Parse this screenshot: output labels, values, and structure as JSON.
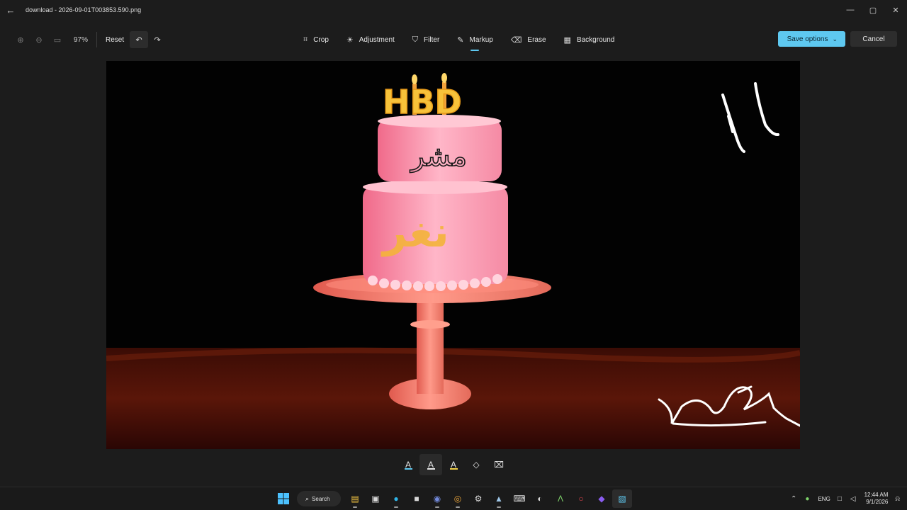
{
  "window": {
    "title": "download - 2026-09-01T003853.590.png",
    "back_icon": "←",
    "minimize_icon": "—",
    "maximize_icon": "▢",
    "close_icon": "✕"
  },
  "toolbar": {
    "zoom_in_icon": "⊕",
    "zoom_out_icon": "⊖",
    "fit_icon": "▭",
    "zoom_level": "97%",
    "reset_label": "Reset",
    "undo_icon": "↶",
    "redo_icon": "↷",
    "tools": [
      {
        "label": "Crop",
        "icon": "⌗"
      },
      {
        "label": "Adjustment",
        "icon": "☀"
      },
      {
        "label": "Filter",
        "icon": "⛉"
      },
      {
        "label": "Markup",
        "icon": "✎"
      },
      {
        "label": "Erase",
        "icon": "⌫"
      },
      {
        "label": "Background",
        "icon": "▦"
      }
    ],
    "active_tool": "Markup",
    "save_label": "Save options",
    "save_chevron": "⌄",
    "cancel_label": "Cancel"
  },
  "canvas": {
    "cake_text_top": "HBD",
    "cake_text_middle": "مشر",
    "cake_text_bottom": "نغر",
    "drawn_number": "11"
  },
  "markup_pens": [
    {
      "name": "ballpoint-pen",
      "icon": "A",
      "color": "#5ec8f0"
    },
    {
      "name": "pencil",
      "icon": "A",
      "color": "#e6e6e6"
    },
    {
      "name": "highlighter",
      "icon": "A",
      "color": "#f2d24a"
    },
    {
      "name": "eraser",
      "icon": "◇",
      "color": "#e6e6e6"
    },
    {
      "name": "clear-all",
      "icon": "⌧",
      "color": "#e6e6e6"
    }
  ],
  "taskbar": {
    "search_label": "Search",
    "language": "ENG",
    "time": "12:44 AM",
    "date": "9/1/2026",
    "apps": [
      {
        "name": "file-explorer",
        "icon": "▤",
        "color": "#f4c542"
      },
      {
        "name": "store",
        "icon": "▣",
        "color": "#d8d8d8"
      },
      {
        "name": "edge",
        "icon": "●",
        "color": "#2fb5e8"
      },
      {
        "name": "epic-games",
        "icon": "■",
        "color": "#d8d8d8"
      },
      {
        "name": "discord",
        "icon": "◉",
        "color": "#7289da"
      },
      {
        "name": "chrome",
        "icon": "◎",
        "color": "#e8a33a"
      },
      {
        "name": "settings",
        "icon": "⚙",
        "color": "#d8d8d8"
      },
      {
        "name": "steam",
        "icon": "▲",
        "color": "#9fc7e8"
      },
      {
        "name": "keyboard",
        "icon": "⌨",
        "color": "#d8d8d8"
      },
      {
        "name": "copilot",
        "icon": "◐",
        "color": "#d8d8d8"
      },
      {
        "name": "green-app",
        "icon": "Λ",
        "color": "#7ed36a"
      },
      {
        "name": "opera",
        "icon": "○",
        "color": "#e0444e"
      },
      {
        "name": "purple-app",
        "icon": "◆",
        "color": "#8a5cf0"
      },
      {
        "name": "photos",
        "icon": "▧",
        "color": "#5ec8f0"
      }
    ]
  },
  "colors": {
    "accent": "#5ec8f0",
    "background": "#1c1c1c"
  }
}
